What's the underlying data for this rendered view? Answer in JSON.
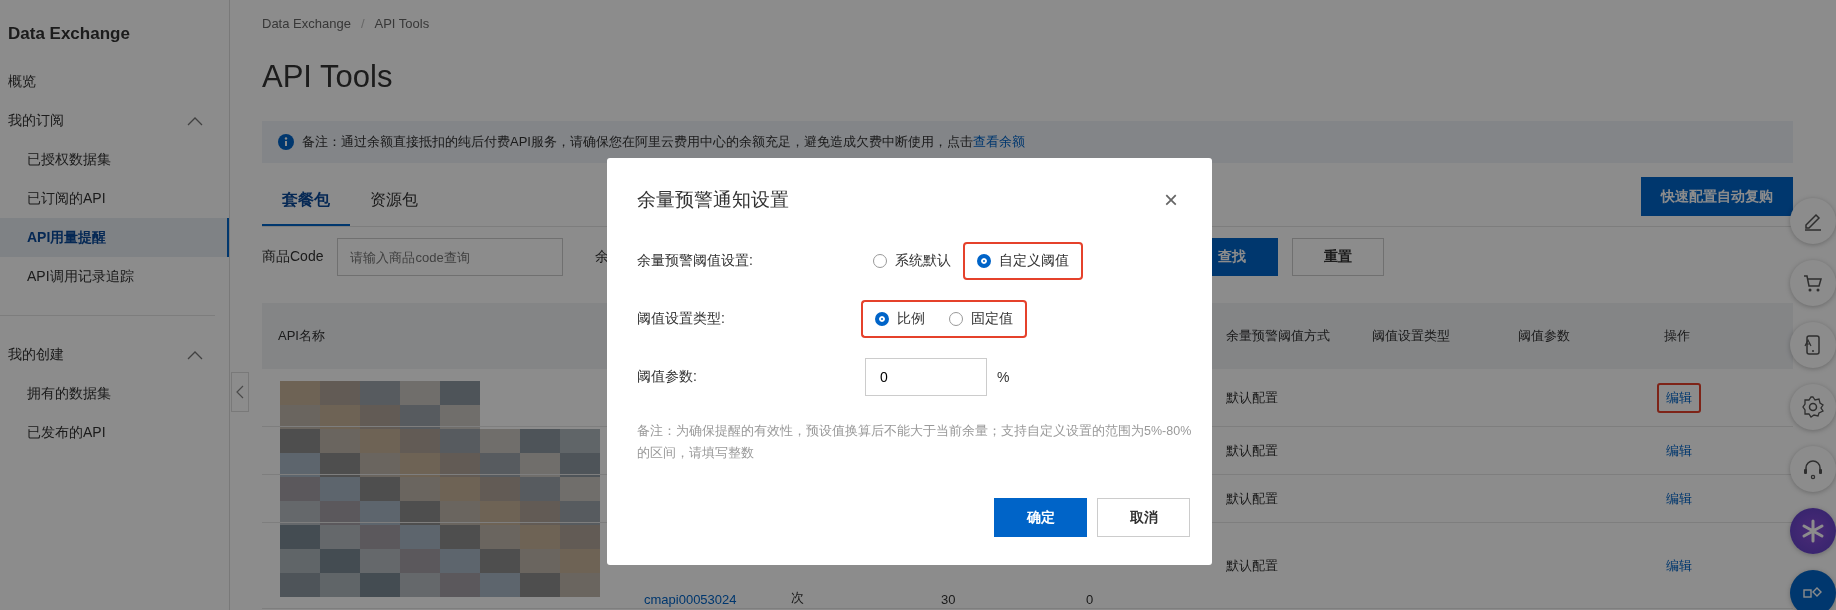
{
  "sidebar": {
    "title": "Data Exchange",
    "items": [
      {
        "label": "概览",
        "selected": false
      },
      {
        "label": "我的订阅",
        "expanded": true,
        "children": [
          {
            "label": "已授权数据集",
            "selected": false
          },
          {
            "label": "已订阅的API",
            "selected": false
          },
          {
            "label": "API用量提醒",
            "selected": true
          },
          {
            "label": "API调用记录追踪",
            "selected": false
          }
        ]
      },
      {
        "label": "我的创建",
        "expanded": true,
        "children": [
          {
            "label": "拥有的数据集",
            "selected": false
          },
          {
            "label": "已发布的API",
            "selected": false
          }
        ]
      }
    ]
  },
  "breadcrumb": [
    "Data Exchange",
    "API Tools"
  ],
  "breadcrumb_separator": "/",
  "page_title": "API Tools",
  "notice": {
    "text": "备注：通过余额直接抵扣的纯后付费API服务，请确保您在阿里云费用中心的余额充足，避免造成欠费中断使用，点击",
    "link": "查看余额"
  },
  "tabs": [
    {
      "label": "套餐包",
      "selected": true
    },
    {
      "label": "资源包",
      "selected": false
    }
  ],
  "quick_button": "快速配置自动复购",
  "filter": {
    "label": "商品Code",
    "placeholder": "请输入商品code查询",
    "label_2": "余",
    "search_button": "查找",
    "reset_button": "重置"
  },
  "table": {
    "columns": [
      "API名称",
      "余量预警阈值方式",
      "阈值设置类型",
      "阈值参数",
      "操作"
    ],
    "rows": [
      {
        "mode": "默认配置",
        "action": "编辑",
        "highlighted": true
      },
      {
        "mode": "默认配置",
        "action": "编辑",
        "highlighted": false
      },
      {
        "mode": "默认配置",
        "action": "编辑",
        "highlighted": false
      },
      {
        "column_2": "cmapi00053024",
        "column_3": "次",
        "column_4": "30",
        "column_5": "0",
        "mode": "默认配置",
        "action": "编辑",
        "highlighted": false
      }
    ]
  },
  "dialog": {
    "title": "余量预警通知设置",
    "close": "×",
    "groups": [
      {
        "label": "余量预警阈值设置:",
        "options": [
          {
            "label": "系统默认",
            "selected": false,
            "highlighted": false
          },
          {
            "label": "自定义阈值",
            "selected": true,
            "highlighted": true
          }
        ]
      },
      {
        "label": "阈值设置类型:",
        "options": [
          {
            "label": "比例",
            "selected": true,
            "highlighted": true
          },
          {
            "label": "固定值",
            "selected": false,
            "highlighted": true
          }
        ]
      }
    ],
    "param": {
      "label": "阈值参数:",
      "value": "0",
      "unit": "%"
    },
    "note": "备注：为确保提醒的有效性，预设值换算后不能大于当前余量；支持自定义设置的范围为5%-80%的区间，请填写整数",
    "ok": "确定",
    "cancel": "取消"
  }
}
